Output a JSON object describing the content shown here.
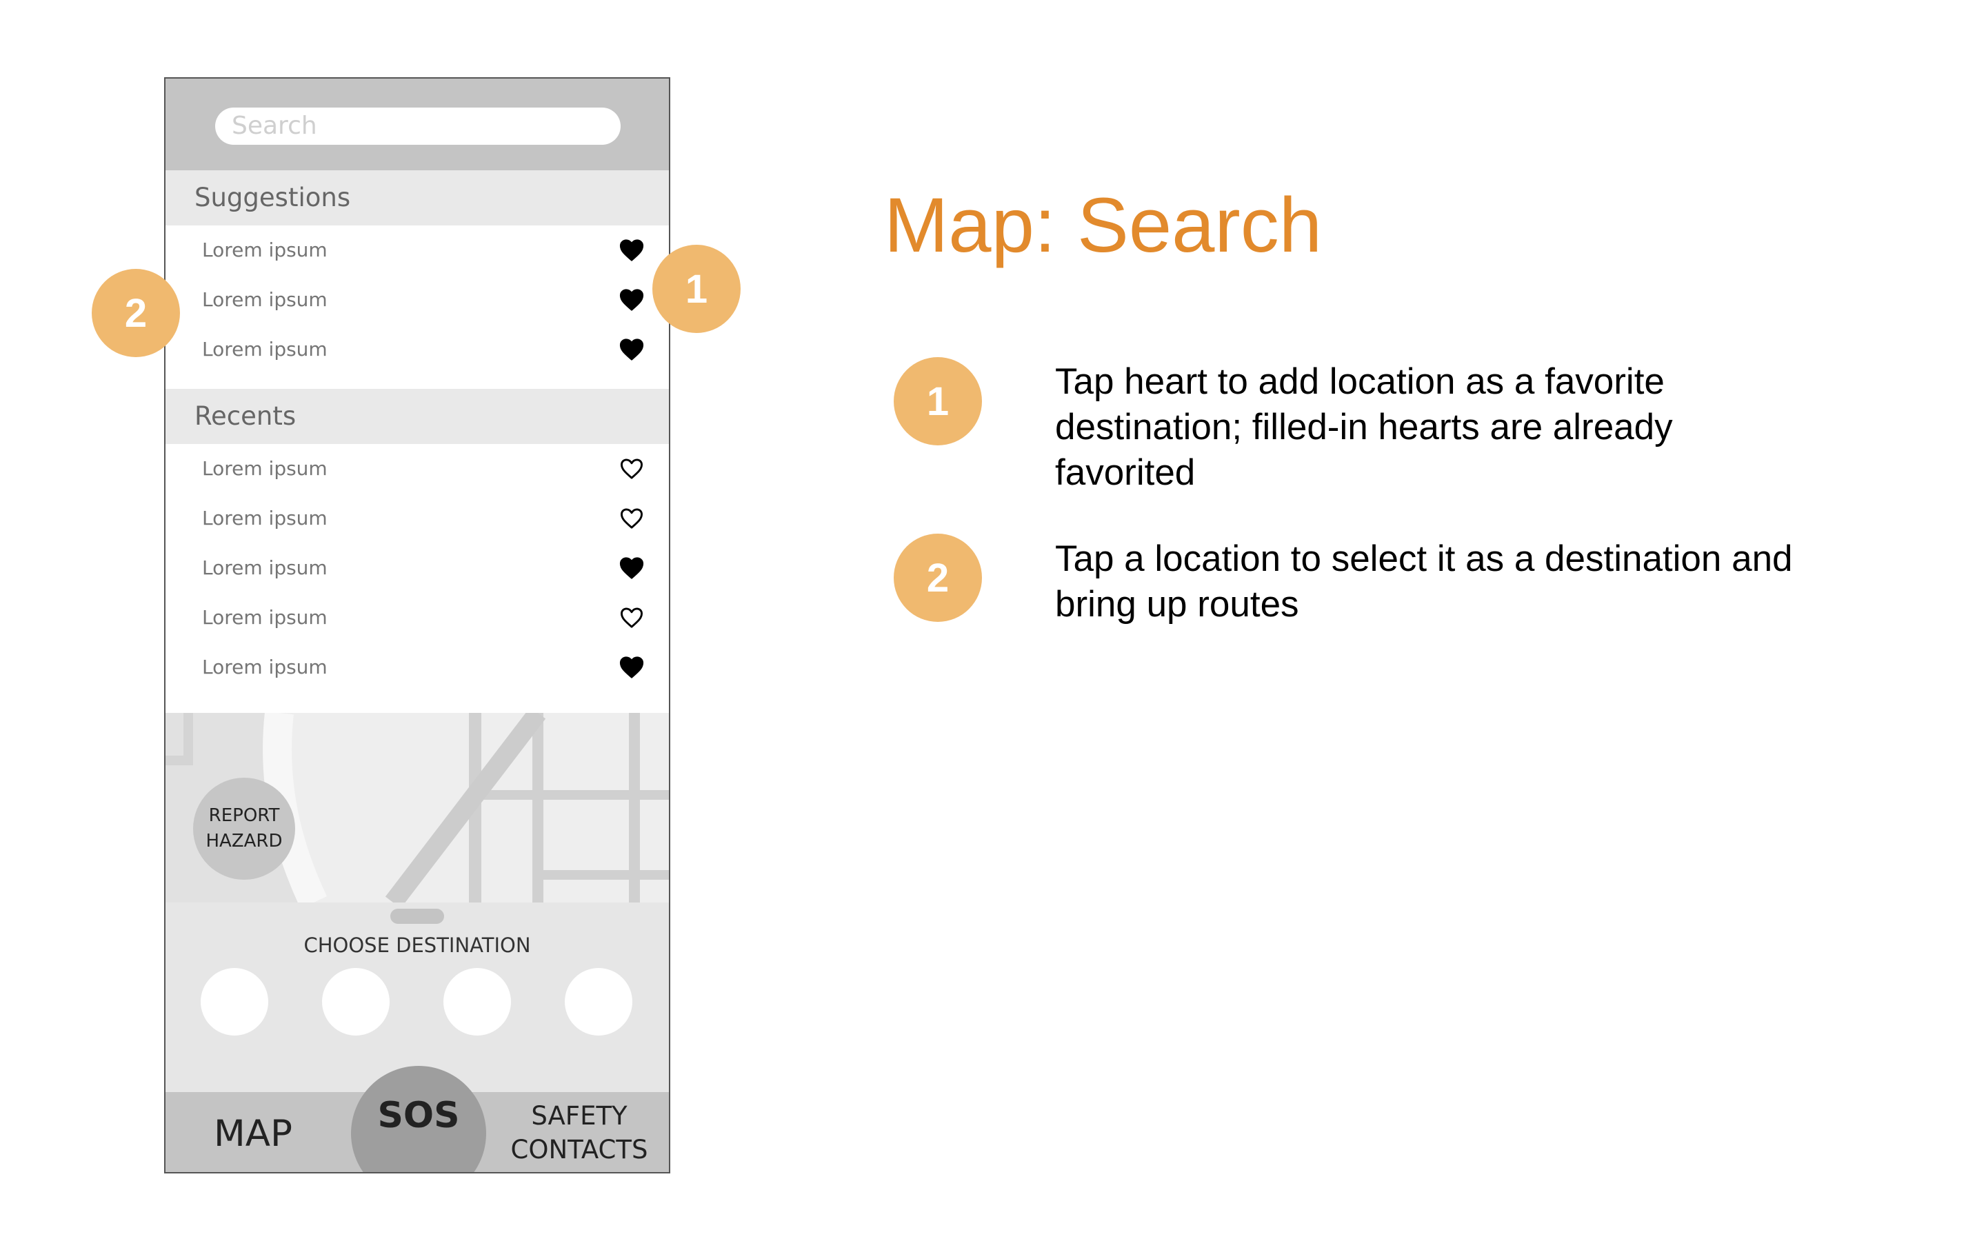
{
  "title": "Map: Search",
  "colors": {
    "title": "#e28a2c",
    "badge": "#f0b96f",
    "phone_chrome": "#c4c4c4",
    "section_header": "#e9e9e9"
  },
  "phone": {
    "search": {
      "placeholder": "Search",
      "icon": "none"
    },
    "suggestions": {
      "header": "Suggestions",
      "items": [
        {
          "label": "Lorem ipsum",
          "favorited": true,
          "icon": "heart-filled"
        },
        {
          "label": "Lorem ipsum",
          "favorited": true,
          "icon": "heart-filled"
        },
        {
          "label": "Lorem ipsum",
          "favorited": true,
          "icon": "heart-filled"
        }
      ]
    },
    "recents": {
      "header": "Recents",
      "items": [
        {
          "label": "Lorem ipsum",
          "favorited": false,
          "icon": "heart-outline"
        },
        {
          "label": "Lorem ipsum",
          "favorited": false,
          "icon": "heart-outline"
        },
        {
          "label": "Lorem ipsum",
          "favorited": true,
          "icon": "heart-filled"
        },
        {
          "label": "Lorem ipsum",
          "favorited": false,
          "icon": "heart-outline"
        },
        {
          "label": "Lorem ipsum",
          "favorited": true,
          "icon": "heart-filled"
        }
      ]
    },
    "report_hazard": {
      "line1": "REPORT",
      "line2": "HAZARD"
    },
    "choose_destination": "CHOOSE DESTINATION",
    "nav": {
      "map": "MAP",
      "sos": "SOS",
      "safety_line1": "SAFETY",
      "safety_line2": "CONTACTS"
    }
  },
  "annotations": [
    {
      "number": "1",
      "text": "Tap heart to add location as a favorite destination; filled-in hearts are already favorited"
    },
    {
      "number": "2",
      "text": "Tap a location to select it as a destination and bring up routes"
    }
  ]
}
